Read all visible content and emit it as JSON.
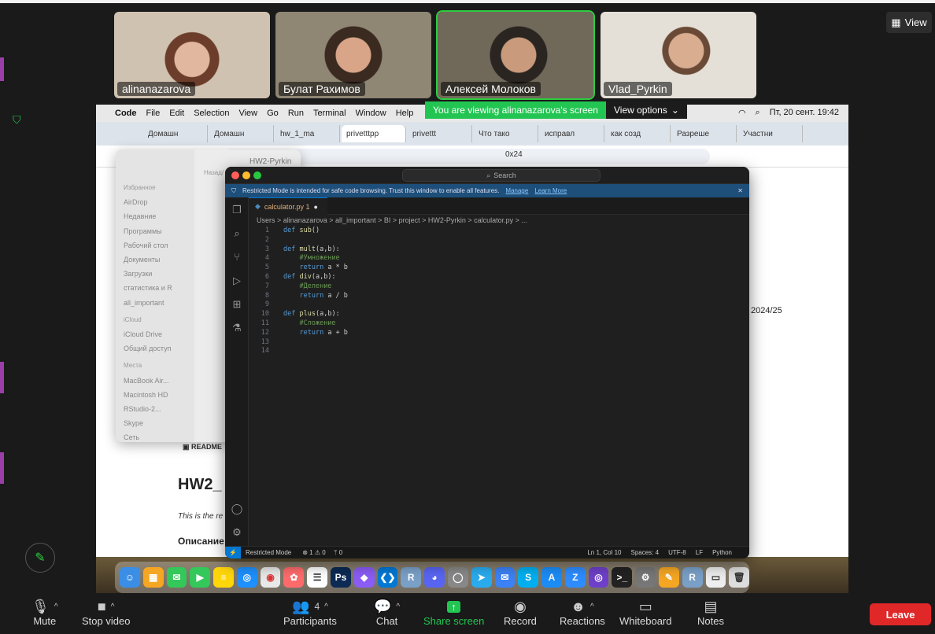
{
  "view_button": {
    "label": "View"
  },
  "participants_video": [
    {
      "name": "alinanazarova",
      "bg": "#c9b9a5"
    },
    {
      "name": "Булат Рахимов",
      "bg": "#8a7d6a"
    },
    {
      "name": "Алексей Молоков",
      "bg": "#6b6456"
    },
    {
      "name": "Vlad_Pyrkin",
      "bg": "#d8d3cb"
    }
  ],
  "share_banner": {
    "text": "You are viewing alinanazarova's screen",
    "options": "View options"
  },
  "mac_menubar": {
    "items": [
      "Code",
      "File",
      "Edit",
      "Selection",
      "View",
      "Go",
      "Run",
      "Terminal",
      "Window",
      "Help"
    ],
    "datetime": "Пт, 20 сент.  19:42"
  },
  "chrome_tabs": [
    "Домашн",
    "Домашн",
    "hw_1_ma",
    "privetttpp",
    "privettt",
    "Что тако",
    "исправл",
    "как созд",
    "Разреше",
    "Участни"
  ],
  "finder": {
    "title": "HW2-Pyrkin",
    "back_label": "Назад/",
    "sections": [
      {
        "header": "Избранное",
        "items": [
          "AirDrop",
          "Недавние",
          "Программы",
          "Рабочий стол",
          "Документы",
          "Загрузки",
          "статистика и R",
          "all_important"
        ]
      },
      {
        "header": "iCloud",
        "items": [
          "iCloud Drive",
          "Общий доступ"
        ]
      },
      {
        "header": "Места",
        "items": [
          "MacBook Air...",
          "Macintosh HD",
          "RStudio-2...",
          "Skype",
          "Сеть"
        ]
      }
    ]
  },
  "github_page": {
    "readme_tab": "README",
    "heading": "HW2_",
    "paragraph": "This is the re",
    "subheading": "Описание",
    "year": "2024/25",
    "commit_partial": "0x24"
  },
  "vscode": {
    "search": "Search",
    "restricted_msg": "Restricted Mode is intended for safe code browsing. Trust this window to enable all features.",
    "manage": "Manage",
    "learn_more": "Learn More",
    "tab_label": "calculator.py 1",
    "breadcrumb": "Users  >  alinanazarova  >  all_important  >  BI  >  project  >  HW2-Pyrkin  >  calculator.py  >  ...",
    "code_lines": [
      "def sub()",
      "",
      "def mult(a,b):",
      "    #Умножение",
      "    return a * b",
      "def div(a,b):",
      "    #Деление",
      "    return a / b",
      "",
      "def plus(a,b):",
      "    #Сложение",
      "    return a + b",
      "",
      ""
    ],
    "status": {
      "mode": "Restricted Mode",
      "problems": "⊗ 1 ⚠ 0",
      "ports": "ᛘ 0",
      "position": "Ln 1, Col 10",
      "spaces": "Spaces: 4",
      "encoding": "UTF-8",
      "eol": "LF",
      "language": "Python"
    }
  },
  "toolbar": {
    "mute": "Mute",
    "stop_video": "Stop video",
    "participants": "Participants",
    "participants_count": "4",
    "chat": "Chat",
    "share_screen": "Share screen",
    "record": "Record",
    "reactions": "Reactions",
    "whiteboard": "Whiteboard",
    "notes": "Notes",
    "leave": "Leave"
  },
  "colors": {
    "accent_green": "#23c552",
    "leave_red": "#e02828",
    "vscode_blue": "#0078d4"
  }
}
